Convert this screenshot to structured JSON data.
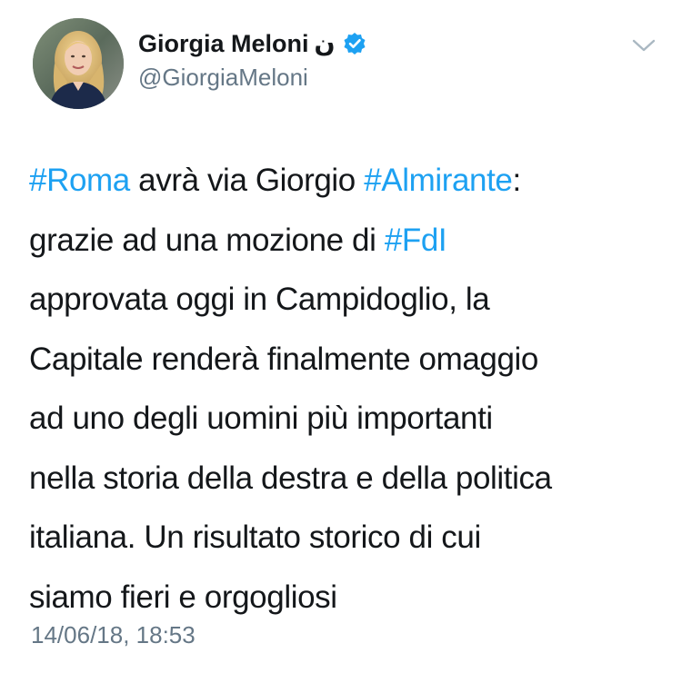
{
  "author": {
    "display_name": "Giorgia Meloni",
    "name_glyph": "ن",
    "handle": "@GiorgiaMeloni",
    "verified": true
  },
  "tweet": {
    "lines": [
      [
        {
          "text": "#Roma",
          "hashtag": true
        },
        {
          "text": " avrà via Giorgio ",
          "hashtag": false
        },
        {
          "text": "#Almirante",
          "hashtag": true
        },
        {
          "text": ":",
          "hashtag": false
        }
      ],
      [
        {
          "text": "grazie ad una mozione di ",
          "hashtag": false
        },
        {
          "text": "#FdI",
          "hashtag": true
        }
      ],
      [
        {
          "text": "approvata oggi in Campidoglio, la",
          "hashtag": false
        }
      ],
      [
        {
          "text": "Capitale renderà finalmente omaggio",
          "hashtag": false
        }
      ],
      [
        {
          "text": "ad uno degli uomini più importanti",
          "hashtag": false
        }
      ],
      [
        {
          "text": "nella storia della destra e della politica",
          "hashtag": false
        }
      ],
      [
        {
          "text": "italiana. Un risultato storico di cui",
          "hashtag": false
        }
      ],
      [
        {
          "text": "siamo fieri e orgogliosi",
          "hashtag": false
        }
      ]
    ],
    "timestamp": "14/06/18, 18:53"
  },
  "icons": {
    "verified": "verified-badge-icon",
    "menu": "chevron-down-icon"
  },
  "colors": {
    "hashtag": "#1da1f2",
    "verified": "#1da1f2",
    "text": "#14171a",
    "secondary": "#657786",
    "chevron": "#aab8c2"
  }
}
